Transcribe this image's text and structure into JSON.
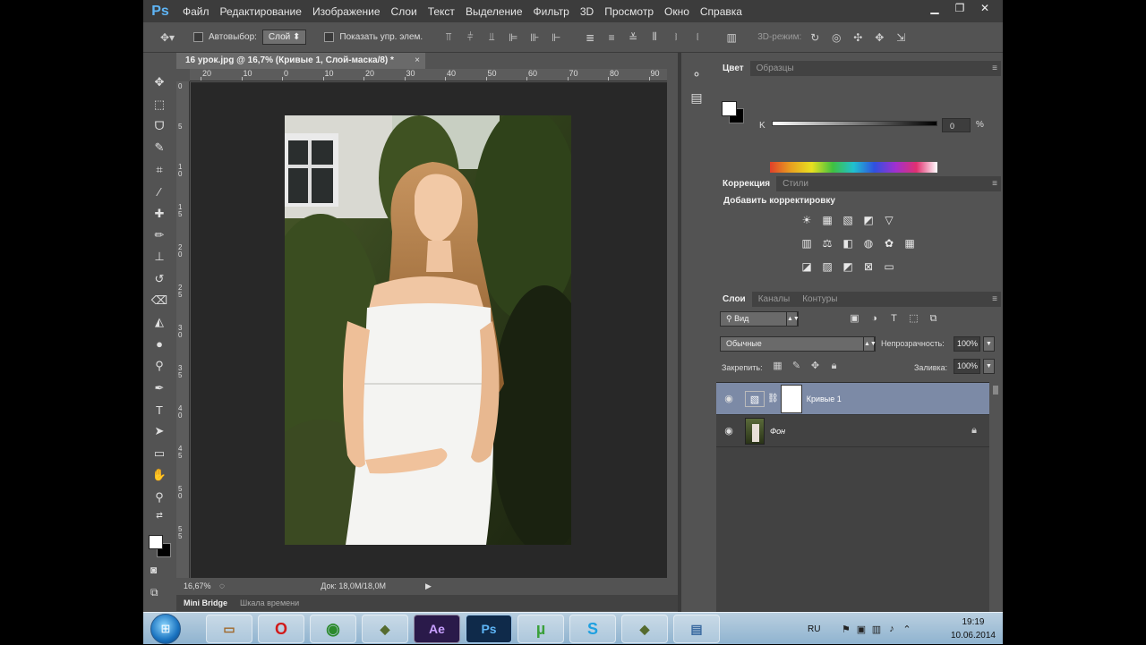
{
  "menubar": {
    "logo": "Ps",
    "items": [
      "Файл",
      "Редактирование",
      "Изображение",
      "Слои",
      "Текст",
      "Выделение",
      "Фильтр",
      "3D",
      "Просмотр",
      "Окно",
      "Справка"
    ],
    "win": [
      "▁",
      "❐",
      "✕"
    ]
  },
  "options": {
    "autoselect_label": "Автовыбор:",
    "autoselect_value": "Слой",
    "show_controls_label": "Показать упр. элем.",
    "mode3d_label": "3D-режим:"
  },
  "document": {
    "tab_title": "16 урок.jpg @ 16,7% (Кривые 1, Слой-маска/8) *",
    "close": "×",
    "ruler_h": [
      "20",
      "10",
      "0",
      "10",
      "20",
      "30",
      "40",
      "50",
      "60",
      "70",
      "80",
      "90"
    ],
    "ruler_v": [
      "0",
      "5",
      "10",
      "15",
      "20",
      "25",
      "30",
      "35",
      "40",
      "45",
      "50",
      "55"
    ]
  },
  "status": {
    "zoom": "16,67%",
    "doc": "Док: 18,0M/18,0M",
    "arrow": "▶"
  },
  "bottom_tabs": {
    "minibridge": "Mini Bridge",
    "timeline": "Шкала времени"
  },
  "panels": {
    "color": {
      "tab_active": "Цвет",
      "tab_other": "Образцы",
      "k_label": "K",
      "k_value": "0",
      "k_unit": "%",
      "fg": "#ffffff",
      "bg": "#000000"
    },
    "correction": {
      "tab_active": "Коррекция",
      "tab_other": "Стили",
      "title": "Добавить корректировку"
    },
    "layers": {
      "tabs": [
        "Слои",
        "Каналы",
        "Контуры"
      ],
      "search": "Вид",
      "blend_mode": "Обычные",
      "opacity_label": "Непрозрачность:",
      "opacity_value": "100%",
      "lock_label": "Закрепить:",
      "fill_label": "Заливка:",
      "fill_value": "100%",
      "items": [
        {
          "name": "Кривые 1",
          "selected": true
        },
        {
          "name": "Фон",
          "selected": false
        }
      ]
    }
  },
  "taskbar": {
    "lang": "RU",
    "time": "19:19",
    "date": "10.06.2014"
  }
}
